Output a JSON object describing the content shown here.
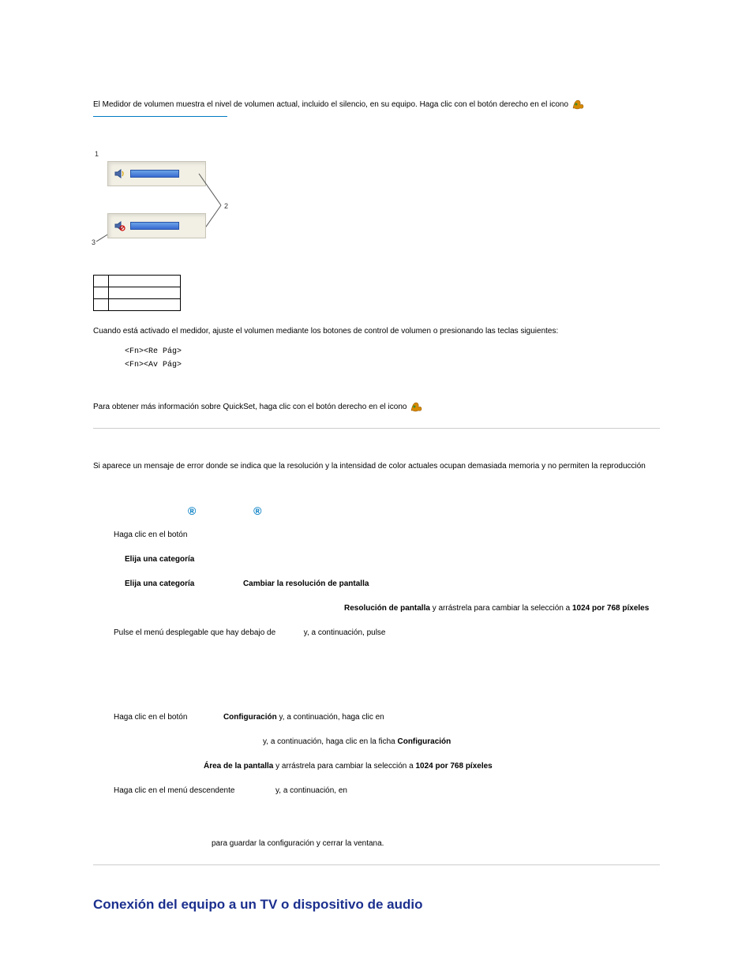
{
  "p1_text": "El Medidor de volumen muestra el nivel de volumen actual, incluido el silencio, en su equipo. Haga clic con el botón derecho en el icono ",
  "icon_name": "quickset-icon",
  "callouts": {
    "n1": "1",
    "n2": "2",
    "n3": "3"
  },
  "p2_text": "Cuando está activado el medidor, ajuste el volumen mediante los botones de control de volumen o presionando las teclas siguientes:",
  "key1": "<Fn><Re Pág>",
  "key2": "<Fn><Av Pág>",
  "p3_text": "Para obtener más información sobre QuickSet, haga clic con el botón derecho en el icono ",
  "p4_text": "Si aparece un mensaje de error donde se indica que la resolución y la intensidad de color actuales ocupan demasiada memoria y no permiten la reproducción",
  "reg_symbol": "®",
  "xp": {
    "s1_a": "Haga clic en el botón ",
    "s2_a": "Elija una categoría",
    "s3_a": "Elija una categoría",
    "s3_b": "Cambiar la resolución de pantalla",
    "s4_a": "Resolución de pantalla",
    "s4_b": " y arrástrela para cambiar la selección a ",
    "s4_c": "1024 por 768 píxeles",
    "s5_a": "Pulse el menú desplegable que hay debajo de ",
    "s5_b": " y, a continuación, pulse "
  },
  "w2k": {
    "s1_a": "Haga clic en el botón ",
    "s1_b": "Configuración",
    "s1_c": " y, a continuación, haga clic en ",
    "s2_a": " y, a continuación, haga clic en la ficha ",
    "s2_b": "Configuración",
    "s3_a": "Área de la pantalla",
    "s3_b": " y arrástrela para cambiar la selección a ",
    "s3_c": "1024 por 768 píxeles",
    "s4_a": "Haga clic en el menú descendente ",
    "s4_b": " y, a continuación, en "
  },
  "p_final": " para guardar la configuración y cerrar la ventana.",
  "h2": "Conexión del equipo a un TV o dispositivo de audio"
}
